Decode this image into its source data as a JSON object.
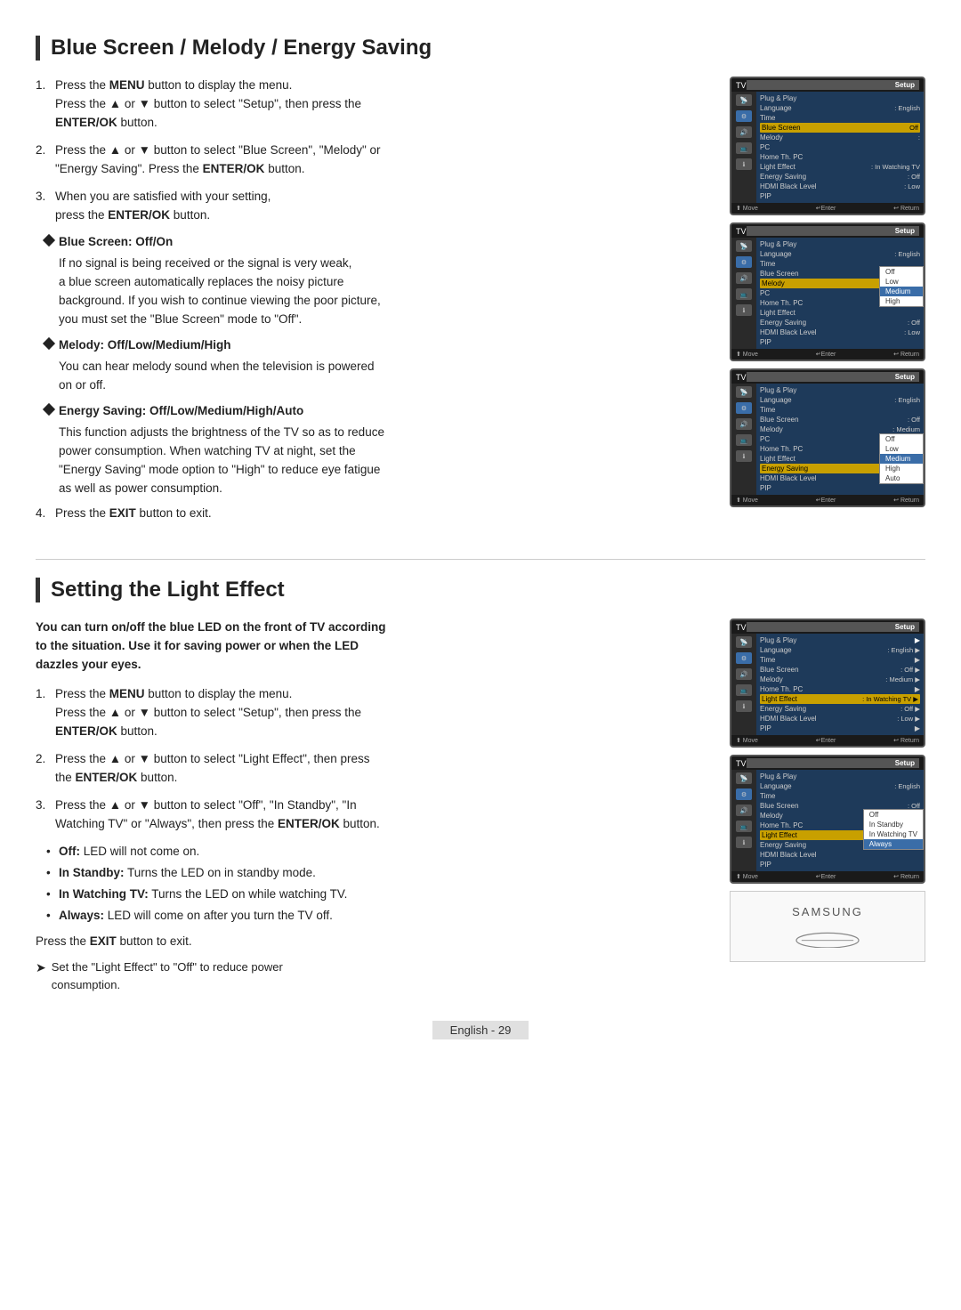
{
  "section1": {
    "title": "Blue Screen / Melody / Energy Saving",
    "steps": [
      {
        "id": 1,
        "text": "Press the MENU button to display the menu.\nPress the ▲ or ▼ button to select \"Setup\", then press the ENTER/OK button.",
        "bold_words": [
          "MENU",
          "ENTER/OK"
        ]
      },
      {
        "id": 2,
        "text": "Press the ▲ or ▼ button to select \"Blue Screen\", \"Melody\" or \"Energy Saving\". Press the ENTER/OK button.",
        "bold_words": [
          "ENTER/OK"
        ]
      },
      {
        "id": 3,
        "text": "When you are satisfied with your setting, press the ENTER/OK button.",
        "bold_words": [
          "ENTER/OK"
        ]
      }
    ],
    "bullets": [
      {
        "id": "blue-screen",
        "title": "Blue Screen: Off/On",
        "description": "If no signal is being received or the signal is very weak, a blue screen automatically replaces the noisy picture background. If you wish to continue viewing the poor picture, you must set the \"Blue Screen\" mode to \"Off\"."
      },
      {
        "id": "melody",
        "title": "Melody: Off/Low/Medium/High",
        "description": "You can hear melody sound when the television is powered on or off."
      },
      {
        "id": "energy-saving",
        "title": "Energy Saving: Off/Low/Medium/High/Auto",
        "description": "This function adjusts the brightness of the TV so as to reduce power consumption. When watching TV at night, set the \"Energy Saving\" mode option to \"High\" to reduce eye fatigue as well as power consumption."
      }
    ],
    "step4": "Press the EXIT button to exit.",
    "step4_bold": "EXIT"
  },
  "section2": {
    "title": "Setting the Light Effect",
    "intro": "You can turn on/off the blue LED on the front of TV according to the situation. Use it for saving power or when the LED dazzles your eyes.",
    "steps": [
      {
        "id": 1,
        "text": "Press the MENU button to display the menu.\nPress the ▲ or ▼ button to select \"Setup\", then press the ENTER/OK button.",
        "bold_words": [
          "MENU",
          "ENTER/OK"
        ]
      },
      {
        "id": 2,
        "text": "Press the ▲ or ▼ button to select \"Light Effect\", then press the ENTER/OK button.",
        "bold_words": [
          "ENTER/OK"
        ]
      },
      {
        "id": 3,
        "text": "Press the ▲ or ▼ button to select \"Off\", \"In Standby\", \"In Watching TV\" or \"Always\", then press the ENTER/OK button.",
        "bold_words": [
          "ENTER/OK"
        ]
      }
    ],
    "sub_bullets": [
      {
        "label": "Off:",
        "text": "LED will not come on.",
        "bold": "Off:"
      },
      {
        "label": "In Standby:",
        "text": "Turns the LED on in standby mode.",
        "bold": "In Standby:"
      },
      {
        "label": "In Watching TV:",
        "text": "Turns the LED on while watching TV.",
        "bold": "In Watching TV:"
      },
      {
        "label": "Always:",
        "text": "LED will come on after you turn the TV off.",
        "bold": "Always:"
      }
    ],
    "exit_text": "Press the EXIT button to exit.",
    "exit_bold": "EXIT",
    "note": "Set the \"Light Effect\" to \"Off\" to reduce power consumption."
  },
  "screens": {
    "screen1_title": "TV | Setup",
    "screen2_title": "TV | Setup",
    "screen3_title": "TV | Setup",
    "menu_items": [
      "Plug & Play",
      "Language",
      "Time",
      "Blue Screen",
      "Melody",
      "PC",
      "Home Theatre PC",
      "Light Effect",
      "Energy Saving",
      "HDMI Black Level",
      "PIP"
    ]
  },
  "footer": {
    "page_label": "English - 29"
  }
}
